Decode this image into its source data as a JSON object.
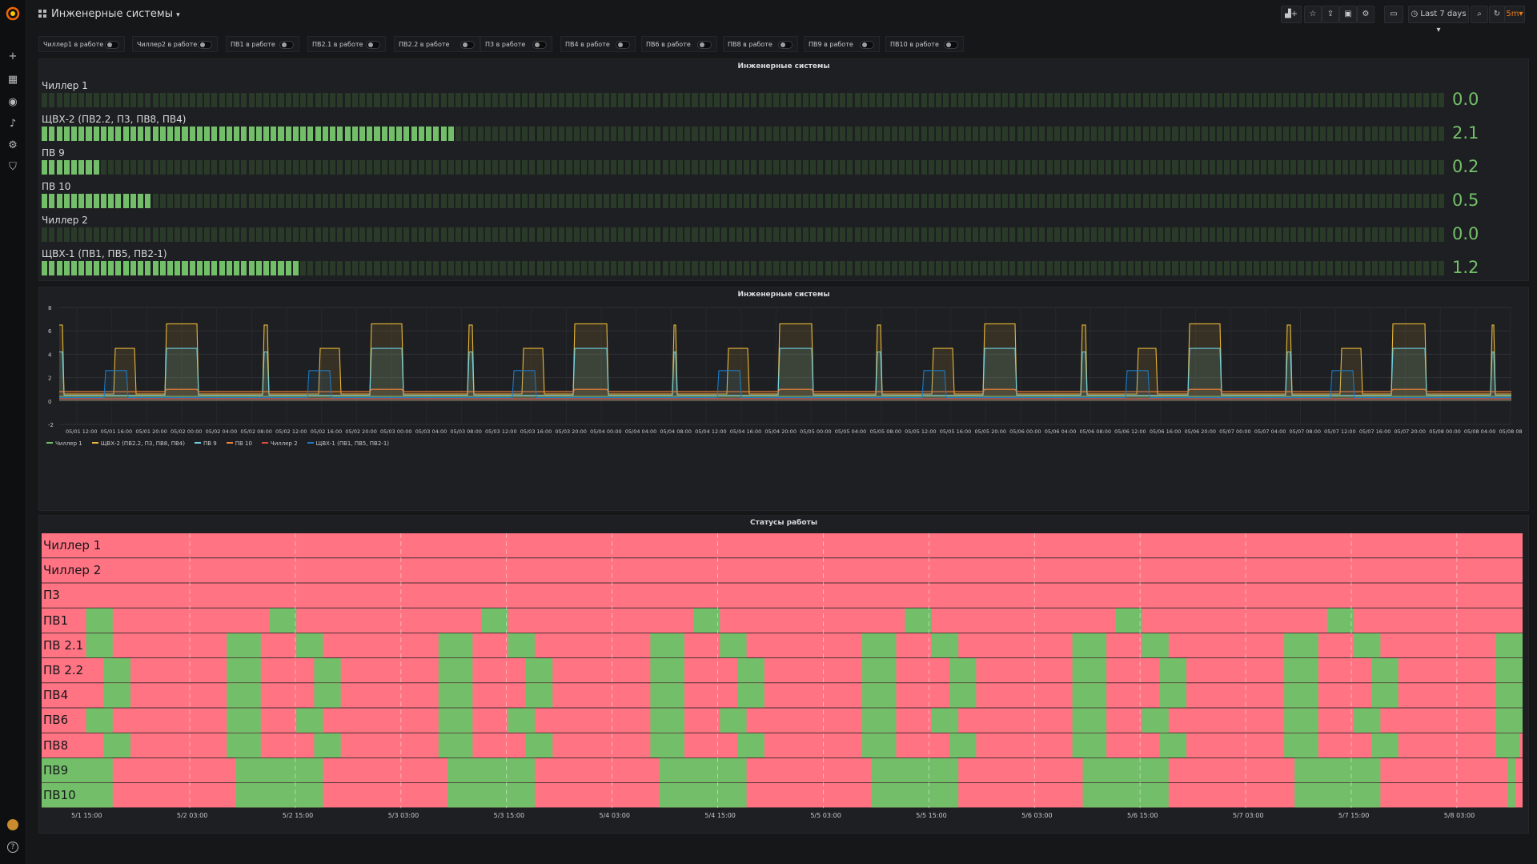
{
  "header": {
    "dashboard_title": "Инженерные системы",
    "time_range_label": "Last 7 days",
    "refresh_interval": "5m",
    "icons": [
      "add-panel-icon",
      "star-icon",
      "share-icon",
      "save-icon",
      "settings-icon",
      "tv-mode-icon",
      "clock-icon",
      "zoom-out-icon",
      "refresh-icon"
    ]
  },
  "sidebar": {
    "icons": [
      "grafana-logo",
      "plus-icon",
      "dashboards-icon",
      "explore-icon",
      "alert-bell-icon",
      "gear-icon",
      "shield-icon",
      "avatar",
      "help-icon"
    ]
  },
  "variables": [
    {
      "label": "Чиллер1 в работе",
      "on": false
    },
    {
      "label": "Чиллер2 в работе",
      "on": false
    },
    {
      "label": "ПВ1 в работе",
      "on": false
    },
    {
      "label": "ПВ2.1 в работе",
      "on": false
    },
    {
      "label": "ПВ2.2 в работе",
      "on": false
    },
    {
      "label": "П3 в работе",
      "on": false
    },
    {
      "label": "ПВ4 в работе",
      "on": false
    },
    {
      "label": "ПВ6 в работе",
      "on": false
    },
    {
      "label": "ПВ8 в работе",
      "on": false
    },
    {
      "label": "ПВ9 в работе",
      "on": false
    },
    {
      "label": "ПВ10 в работе",
      "on": false
    }
  ],
  "gauge_panel": {
    "title": "Инженерные системы",
    "max": 7,
    "rows": [
      {
        "label": "Чиллер 1",
        "value": "0.0",
        "fraction": 0.002
      },
      {
        "label": "ЩВХ-2 (ПВ2.2, П3, ПВ8, ПВ4)",
        "value": "2.1",
        "fraction": 0.295
      },
      {
        "label": "ПВ 9",
        "value": "0.2",
        "fraction": 0.042
      },
      {
        "label": "ПВ 10",
        "value": "0.5",
        "fraction": 0.08
      },
      {
        "label": "Чиллер 2",
        "value": "0.0",
        "fraction": 0.002
      },
      {
        "label": "ЩВХ-1 (ПВ1, ПВ5, ПВ2-1)",
        "value": "1.2",
        "fraction": 0.183
      }
    ],
    "colors": {
      "filled": "#73bf69",
      "empty": "#2a3a28"
    }
  },
  "graph_panel": {
    "title": "Инженерные системы",
    "chart_data": {
      "type": "line",
      "ylim": [
        -2,
        8
      ],
      "y_ticks": [
        "8",
        "6",
        "4",
        "2",
        "0",
        "-2"
      ],
      "x_ticks": [
        "05/01 12:00",
        "05/01 16:00",
        "05/01 20:00",
        "05/02 00:00",
        "05/02 04:00",
        "05/02 08:00",
        "05/02 12:00",
        "05/02 16:00",
        "05/02 20:00",
        "05/03 00:00",
        "05/03 04:00",
        "05/03 08:00",
        "05/03 12:00",
        "05/03 16:00",
        "05/03 20:00",
        "05/04 00:00",
        "05/04 04:00",
        "05/04 08:00",
        "05/04 12:00",
        "05/04 16:00",
        "05/04 20:00",
        "05/05 00:00",
        "05/05 04:00",
        "05/05 08:00",
        "05/05 12:00",
        "05/05 16:00",
        "05/05 20:00",
        "05/06 00:00",
        "05/06 04:00",
        "05/06 08:00",
        "05/06 12:00",
        "05/06 16:00",
        "05/06 20:00",
        "05/07 00:00",
        "05/07 04:00",
        "05/07 08:00",
        "05/07 12:00",
        "05/07 16:00",
        "05/07 20:00",
        "05/08 00:00",
        "05/08 04:00",
        "05/08 08:00"
      ],
      "series": [
        {
          "name": "Чиллер 1",
          "color": "#73bf69"
        },
        {
          "name": "ЩВХ-2 (ПВ2.2, П3, ПВ8, ПВ4)",
          "color": "#eab839"
        },
        {
          "name": "ПВ 9",
          "color": "#6ed0e0"
        },
        {
          "name": "ПВ 10",
          "color": "#ef843c"
        },
        {
          "name": "Чиллер 2",
          "color": "#e24d42"
        },
        {
          "name": "ЩВХ-1 (ПВ1, ПВ5, ПВ2-1)",
          "color": "#1f78c1"
        }
      ]
    }
  },
  "status_panel": {
    "title": "Статусы работы",
    "rows": [
      "Чиллер 1",
      "Чиллер 2",
      "П3",
      "ПВ1",
      "ПВ 2.1",
      "ПВ 2.2",
      "ПВ4",
      "ПВ6",
      "ПВ8",
      "ПВ9",
      "ПВ10"
    ],
    "time_labels": [
      "5/1 15:00",
      "5/2 03:00",
      "5/2 15:00",
      "5/3 03:00",
      "5/3 15:00",
      "5/4 03:00",
      "5/4 15:00",
      "5/5 03:00",
      "5/5 15:00",
      "5/6 03:00",
      "5/6 15:00",
      "5/7 03:00",
      "5/7 15:00",
      "5/8 03:00"
    ],
    "colors": {
      "off": "#ff7383",
      "on": "#73bf69"
    }
  }
}
